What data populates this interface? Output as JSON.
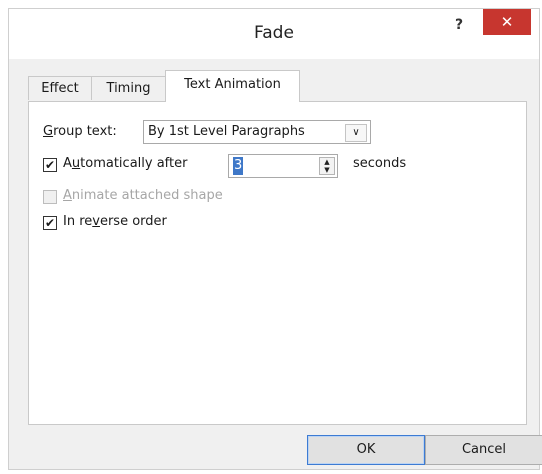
{
  "window": {
    "title": "Fade",
    "help_label": "?",
    "close_label": "✕"
  },
  "tabs": [
    {
      "label": "Effect",
      "selected": false
    },
    {
      "label": "Timing",
      "selected": false
    },
    {
      "label": "Text Animation",
      "selected": true
    }
  ],
  "group_text": {
    "label_prefix": "G",
    "label_rest": "roup text:",
    "value": "By 1st Level Paragraphs",
    "arrow_icon": "chevron-down-icon"
  },
  "auto_after": {
    "checked": true,
    "check_glyph": "✔",
    "label_a": "A",
    "label_u": "u",
    "label_rest": "tomatically after",
    "value": "3",
    "unit": "seconds"
  },
  "animate_shape": {
    "checked": false,
    "label_prefix": "A",
    "label_rest": "nimate attached shape"
  },
  "reverse_order": {
    "checked": true,
    "check_glyph": "✔",
    "label_a": "In re",
    "label_u": "v",
    "label_rest": "erse order"
  },
  "buttons": {
    "ok": "OK",
    "cancel": "Cancel"
  }
}
